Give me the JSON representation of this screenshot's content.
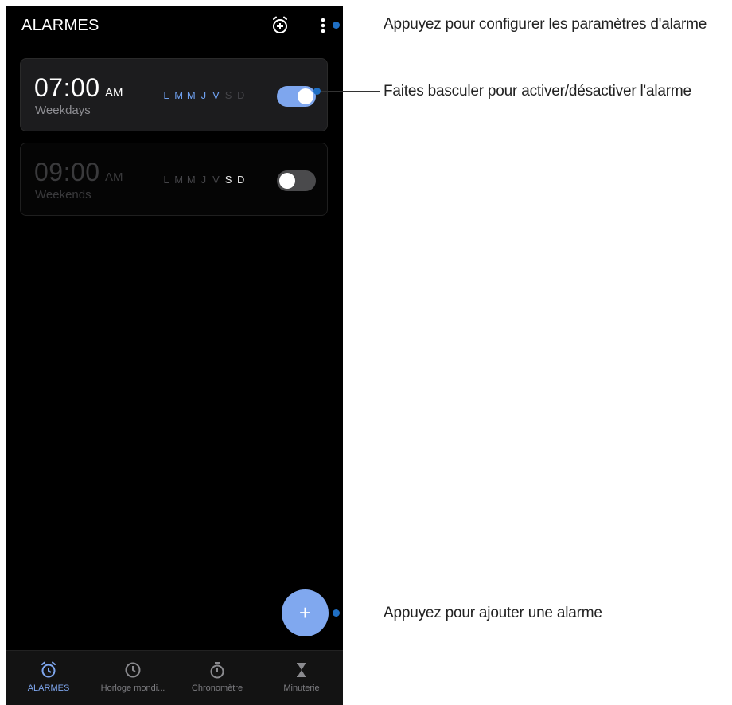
{
  "header": {
    "title": "ALARMES",
    "add_icon": "alarm-add-icon",
    "menu_icon": "more-vert-icon"
  },
  "alarms": [
    {
      "time": "07:00",
      "ampm": "AM",
      "label": "Weekdays",
      "days": [
        "L",
        "M",
        "M",
        "J",
        "V",
        "S",
        "D"
      ],
      "active_days": [
        true,
        true,
        true,
        true,
        true,
        false,
        false
      ],
      "enabled": true
    },
    {
      "time": "09:00",
      "ampm": "AM",
      "label": "Weekends",
      "days": [
        "L",
        "M",
        "M",
        "J",
        "V",
        "S",
        "D"
      ],
      "active_days": [
        false,
        false,
        false,
        false,
        false,
        true,
        true
      ],
      "enabled": false
    }
  ],
  "fab": {
    "icon": "plus-icon",
    "glyph": "+"
  },
  "bottom_nav": [
    {
      "label": "ALARMES",
      "icon": "alarm-clock-icon",
      "active": true
    },
    {
      "label": "Horloge mondi...",
      "icon": "world-clock-icon",
      "active": false
    },
    {
      "label": "Chronomètre",
      "icon": "stopwatch-icon",
      "active": false
    },
    {
      "label": "Minuterie",
      "icon": "hourglass-icon",
      "active": false
    }
  ],
  "callouts": {
    "settings": "Appuyez pour configurer les paramètres d'alarme",
    "toggle": "Faites basculer pour activer/désactiver l'alarme",
    "add": "Appuyez pour ajouter une alarme"
  },
  "colors": {
    "accent": "#7ea6ee",
    "callout_dot": "#1f6fc4",
    "background": "#000000"
  }
}
